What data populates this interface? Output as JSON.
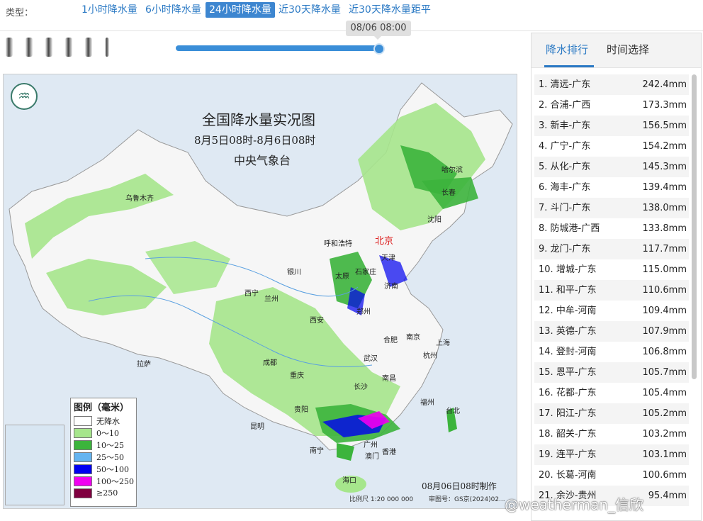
{
  "type_label": "类型：",
  "tabs": [
    {
      "label": "1小时降水量",
      "active": false
    },
    {
      "label": "6小时降水量",
      "active": false
    },
    {
      "label": "24小时降水量",
      "active": true
    },
    {
      "label": "近30天降水量",
      "active": false
    },
    {
      "label": "近30天降水量距平",
      "active": false
    }
  ],
  "slider": {
    "tooltip": "08/06 08:00",
    "progress": 1.0
  },
  "map": {
    "title": "全国降水量实况图",
    "subtitle": "8月5日08时-8月6日08时",
    "org": "中央气象台",
    "made": "08月06日08时制作",
    "scale": "比例尺 1:20 000 000",
    "review": "审图号：GS京(2024)02...",
    "cities": [
      {
        "name": "哈尔滨",
        "capital": false
      },
      {
        "name": "长春",
        "capital": false
      },
      {
        "name": "乌鲁木齐",
        "capital": false
      },
      {
        "name": "沈阳",
        "capital": false
      },
      {
        "name": "呼和浩特",
        "capital": false
      },
      {
        "name": "北京",
        "capital": true
      },
      {
        "name": "天津",
        "capital": false
      },
      {
        "name": "银川",
        "capital": false
      },
      {
        "name": "太原",
        "capital": false
      },
      {
        "name": "石家庄",
        "capital": false
      },
      {
        "name": "济南",
        "capital": false
      },
      {
        "name": "西宁",
        "capital": false
      },
      {
        "name": "兰州",
        "capital": false
      },
      {
        "name": "郑州",
        "capital": false
      },
      {
        "name": "西安",
        "capital": false
      },
      {
        "name": "南京",
        "capital": false
      },
      {
        "name": "上海",
        "capital": false
      },
      {
        "name": "合肥",
        "capital": false
      },
      {
        "name": "杭州",
        "capital": false
      },
      {
        "name": "武汉",
        "capital": false
      },
      {
        "name": "成都",
        "capital": false
      },
      {
        "name": "拉萨",
        "capital": false
      },
      {
        "name": "重庆",
        "capital": false
      },
      {
        "name": "南昌",
        "capital": false
      },
      {
        "name": "长沙",
        "capital": false
      },
      {
        "name": "福州",
        "capital": false
      },
      {
        "name": "台北",
        "capital": false
      },
      {
        "name": "贵阳",
        "capital": false
      },
      {
        "name": "昆明",
        "capital": false
      },
      {
        "name": "南宁",
        "capital": false
      },
      {
        "name": "广州",
        "capital": false
      },
      {
        "name": "香港",
        "capital": false
      },
      {
        "name": "澳门",
        "capital": false
      },
      {
        "name": "海口",
        "capital": false
      }
    ],
    "legend": {
      "title": "图例（毫米）",
      "items": [
        {
          "label": "无降水",
          "color": "#ffffff"
        },
        {
          "label": "0～10",
          "color": "#a6e68c"
        },
        {
          "label": "10～25",
          "color": "#3cb43c"
        },
        {
          "label": "25～50",
          "color": "#64b4f0"
        },
        {
          "label": "50～100",
          "color": "#0000f0"
        },
        {
          "label": "100～250",
          "color": "#f000f0"
        },
        {
          "label": "≥250",
          "color": "#800040"
        }
      ]
    }
  },
  "panel": {
    "tabs": [
      {
        "label": "降水排行",
        "active": true
      },
      {
        "label": "时间选择",
        "active": false
      }
    ],
    "ranking": [
      {
        "rank": "1.",
        "name": "清远-广东",
        "value": "242.4mm"
      },
      {
        "rank": "2.",
        "name": "合浦-广西",
        "value": "173.3mm"
      },
      {
        "rank": "3.",
        "name": "新丰-广东",
        "value": "156.5mm"
      },
      {
        "rank": "4.",
        "name": "广宁-广东",
        "value": "154.2mm"
      },
      {
        "rank": "5.",
        "name": "从化-广东",
        "value": "145.3mm"
      },
      {
        "rank": "6.",
        "name": "海丰-广东",
        "value": "139.4mm"
      },
      {
        "rank": "7.",
        "name": "斗门-广东",
        "value": "138.0mm"
      },
      {
        "rank": "8.",
        "name": "防城港-广西",
        "value": "133.8mm"
      },
      {
        "rank": "9.",
        "name": "龙门-广东",
        "value": "117.7mm"
      },
      {
        "rank": "10.",
        "name": "增城-广东",
        "value": "115.0mm"
      },
      {
        "rank": "11.",
        "name": "和平-广东",
        "value": "110.6mm"
      },
      {
        "rank": "12.",
        "name": "中牟-河南",
        "value": "109.4mm"
      },
      {
        "rank": "13.",
        "name": "英德-广东",
        "value": "107.9mm"
      },
      {
        "rank": "14.",
        "name": "登封-河南",
        "value": "106.8mm"
      },
      {
        "rank": "15.",
        "name": "恩平-广东",
        "value": "105.7mm"
      },
      {
        "rank": "16.",
        "name": "花都-广东",
        "value": "105.4mm"
      },
      {
        "rank": "17.",
        "name": "阳江-广东",
        "value": "105.2mm"
      },
      {
        "rank": "18.",
        "name": "韶关-广东",
        "value": "103.2mm"
      },
      {
        "rank": "19.",
        "name": "连平-广东",
        "value": "103.1mm"
      },
      {
        "rank": "20.",
        "name": "长葛-河南",
        "value": "100.6mm"
      },
      {
        "rank": "21.",
        "name": "余沙-贵州",
        "value": "95.4mm"
      }
    ]
  },
  "watermark": "@weatherman_信欣"
}
